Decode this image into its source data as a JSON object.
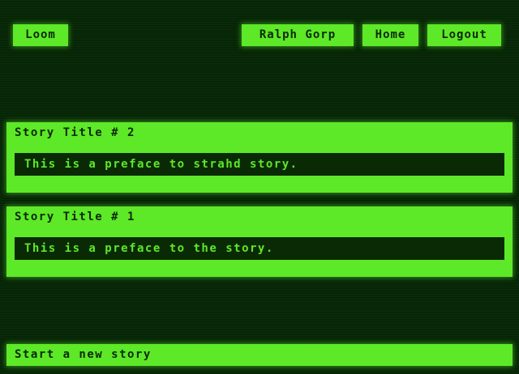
{
  "nav": {
    "brand": "Loom",
    "user": "Ralph Gorp",
    "home": "Home",
    "logout": "Logout"
  },
  "stories": [
    {
      "title": "Story Title # 2",
      "preface": "This is a preface to strahd story."
    },
    {
      "title": "Story Title # 1",
      "preface": "This is a preface to the story."
    }
  ],
  "new_story": "Start a new story",
  "colors": {
    "background": "#062606",
    "accent": "#5de828",
    "dark_text": "#0b2a06"
  }
}
